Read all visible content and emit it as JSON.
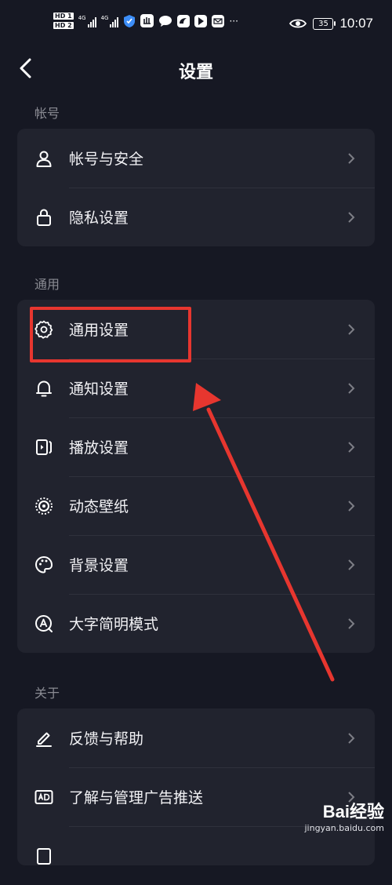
{
  "status": {
    "left_badges": [
      "HD 1",
      "HD 2"
    ],
    "network": "4G",
    "battery": "35",
    "time": "10:07"
  },
  "nav": {
    "title": "设置"
  },
  "sections": [
    {
      "label": "帐号",
      "items": [
        {
          "label": "帐号与安全",
          "icon": "user-icon"
        },
        {
          "label": "隐私设置",
          "icon": "lock-icon"
        }
      ]
    },
    {
      "label": "通用",
      "items": [
        {
          "label": "通用设置",
          "icon": "gear-icon"
        },
        {
          "label": "通知设置",
          "icon": "bell-icon"
        },
        {
          "label": "播放设置",
          "icon": "play-settings-icon"
        },
        {
          "label": "动态壁纸",
          "icon": "live-wallpaper-icon"
        },
        {
          "label": "背景设置",
          "icon": "palette-icon"
        },
        {
          "label": "大字简明模式",
          "icon": "large-text-icon"
        }
      ]
    },
    {
      "label": "关于",
      "items": [
        {
          "label": "反馈与帮助",
          "icon": "edit-icon"
        },
        {
          "label": "了解与管理广告推送",
          "icon": "ad-icon"
        }
      ]
    }
  ],
  "colors": {
    "background": "#161823",
    "card": "#21232e",
    "annotation": "#e7362f"
  },
  "watermark": {
    "main": "Bai经验",
    "sub": "jingyan.baidu.com"
  }
}
